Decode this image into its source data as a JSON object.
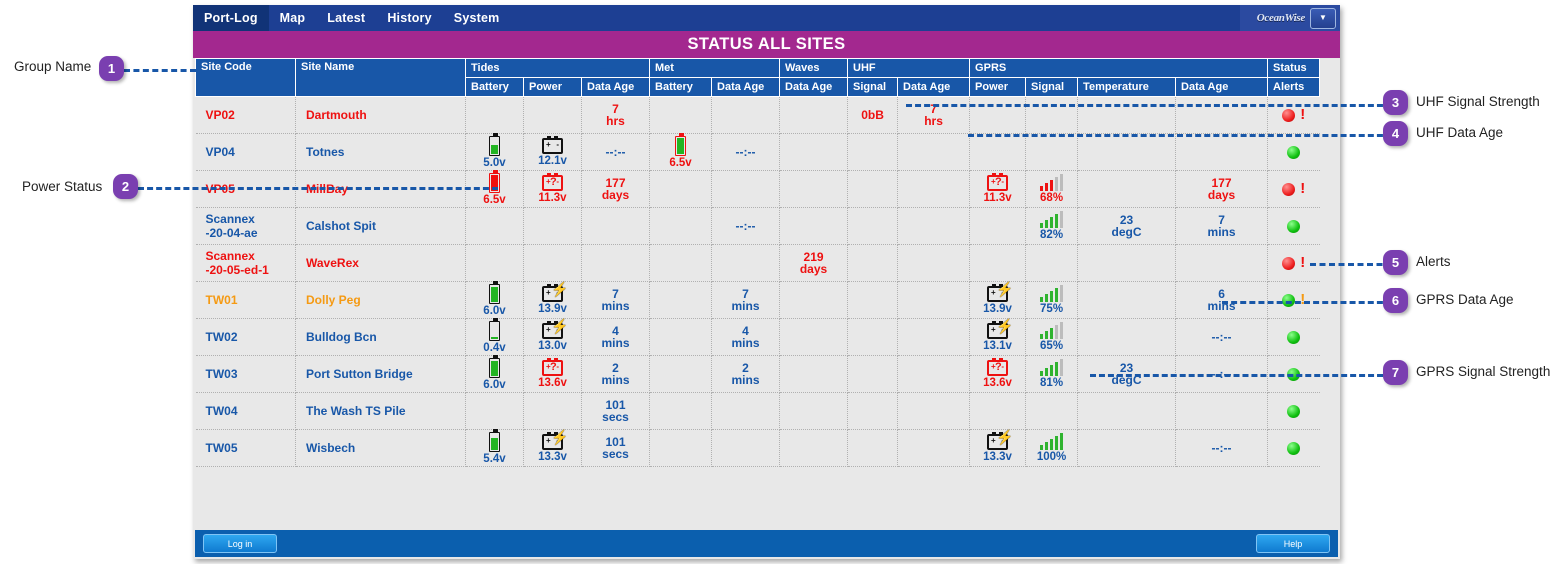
{
  "nav": {
    "items": [
      {
        "label": "Port-Log",
        "active": true
      },
      {
        "label": "Map",
        "active": false
      },
      {
        "label": "Latest",
        "active": false
      },
      {
        "label": "History",
        "active": false
      },
      {
        "label": "System",
        "active": false
      }
    ],
    "brand": "OceanWise",
    "dropdown_icon": "chevron-down-icon"
  },
  "title": "STATUS   ALL SITES",
  "table": {
    "groups": [
      {
        "label": "Site Code",
        "span": 1
      },
      {
        "label": "Site Name",
        "span": 1
      },
      {
        "label": "Tides",
        "span": 3
      },
      {
        "label": "Met",
        "span": 2
      },
      {
        "label": "Waves",
        "span": 1
      },
      {
        "label": "UHF",
        "span": 2
      },
      {
        "label": "GPRS",
        "span": 4
      },
      {
        "label": "Status",
        "span": 1
      }
    ],
    "columns": [
      "Site Code",
      "Site Name",
      "Battery",
      "Power",
      "Data Age",
      "Battery",
      "Data Age",
      "Data Age",
      "Signal",
      "Data Age",
      "Power",
      "Signal",
      "Temperature",
      "Data Age",
      "Alerts"
    ],
    "rows": [
      {
        "site_code": "VP02",
        "site_name": "Dartmouth",
        "color": "red",
        "tides_battery": null,
        "tides_power": null,
        "tides_data_age": "7 hrs",
        "tides_data_age_color": "red",
        "met_battery": null,
        "met_data_age": null,
        "waves_data_age": null,
        "uhf_signal": "0bB",
        "uhf_signal_color": "red",
        "uhf_data_age": "7 hrs",
        "uhf_data_age_color": "red",
        "gprs_power": null,
        "gprs_signal": null,
        "gprs_temperature": null,
        "gprs_data_age": null,
        "status": "red",
        "alert": true,
        "alert_color": "red"
      },
      {
        "site_code": "VP04",
        "site_name": "Totnes",
        "color": "blue",
        "tides_battery": "5.0v",
        "tides_battery_color": "blue",
        "tides_battery_level": 55,
        "tides_battery_fill": "green",
        "tides_power": "12.1v",
        "tides_power_color": "blue",
        "tides_power_icon": "battery-terminals",
        "tides_data_age": "--:--",
        "tides_data_age_color": "blue",
        "met_battery": "6.5v",
        "met_battery_color": "red",
        "met_battery_level": 95,
        "met_battery_fill": "green",
        "met_data_age": "--:--",
        "met_data_age_color": "blue",
        "waves_data_age": null,
        "uhf_signal": null,
        "uhf_data_age": null,
        "gprs_power": null,
        "gprs_signal": null,
        "gprs_temperature": null,
        "gprs_data_age": null,
        "status": "green",
        "alert": false
      },
      {
        "site_code": "VP05",
        "site_name": "MillBay",
        "color": "red",
        "tides_battery": "6.5v",
        "tides_battery_color": "red",
        "tides_battery_level": 95,
        "tides_battery_fill": "red",
        "tides_power": "11.3v",
        "tides_power_color": "red",
        "tides_power_icon": "battery-fault",
        "tides_data_age": "177 days",
        "tides_data_age_color": "red",
        "met_battery": null,
        "met_data_age": null,
        "waves_data_age": null,
        "uhf_signal": null,
        "uhf_data_age": null,
        "gprs_power": "11.3v",
        "gprs_power_color": "red",
        "gprs_power_icon": "battery-fault",
        "gprs_signal": "68%",
        "gprs_signal_color": "red",
        "gprs_signal_pct": 68,
        "gprs_temperature": null,
        "gprs_data_age": "177 days",
        "gprs_data_age_color": "red",
        "status": "red",
        "alert": true,
        "alert_color": "red"
      },
      {
        "site_code": "Scannex -20-04-ae",
        "site_name": "Calshot Spit",
        "color": "blue",
        "tides_battery": null,
        "tides_power": null,
        "tides_data_age": null,
        "met_battery": null,
        "met_data_age": "--:--",
        "met_data_age_color": "blue",
        "waves_data_age": null,
        "uhf_signal": null,
        "uhf_data_age": null,
        "gprs_power": null,
        "gprs_signal": "82%",
        "gprs_signal_color": "green",
        "gprs_signal_pct": 82,
        "gprs_temperature": "23 degC",
        "gprs_temperature_color": "blue",
        "gprs_data_age": "7 mins",
        "gprs_data_age_color": "blue",
        "status": "green",
        "alert": false
      },
      {
        "site_code": "Scannex -20-05-ed-1",
        "site_name": "WaveRex",
        "color": "red",
        "tides_battery": null,
        "tides_power": null,
        "tides_data_age": null,
        "met_battery": null,
        "met_data_age": null,
        "waves_data_age": "219 days",
        "waves_data_age_color": "red",
        "uhf_signal": null,
        "uhf_data_age": null,
        "gprs_power": null,
        "gprs_signal": null,
        "gprs_temperature": null,
        "gprs_data_age": null,
        "status": "red",
        "alert": true,
        "alert_color": "red"
      },
      {
        "site_code": "TW01",
        "site_name": "Dolly Peg",
        "color": "orange",
        "tides_battery": "6.0v",
        "tides_battery_color": "blue",
        "tides_battery_level": 90,
        "tides_battery_fill": "green",
        "tides_power": "13.9v",
        "tides_power_color": "blue",
        "tides_power_icon": "battery-charging",
        "tides_data_age": "7 mins",
        "tides_data_age_color": "blue",
        "met_battery": null,
        "met_data_age": "7 mins",
        "met_data_age_color": "blue",
        "waves_data_age": null,
        "uhf_signal": null,
        "uhf_data_age": null,
        "gprs_power": "13.9v",
        "gprs_power_color": "blue",
        "gprs_power_icon": "battery-charging",
        "gprs_signal": "75%",
        "gprs_signal_color": "green",
        "gprs_signal_pct": 75,
        "gprs_temperature": null,
        "gprs_data_age": "6 mins",
        "gprs_data_age_color": "blue",
        "status": "green",
        "alert": true,
        "alert_color": "orange"
      },
      {
        "site_code": "TW02",
        "site_name": "Bulldog Bcn",
        "color": "blue",
        "tides_battery": "0.4v",
        "tides_battery_color": "blue",
        "tides_battery_level": 6,
        "tides_battery_fill": "green",
        "tides_power": "13.0v",
        "tides_power_color": "blue",
        "tides_power_icon": "battery-charging",
        "tides_data_age": "4 mins",
        "tides_data_age_color": "blue",
        "met_battery": null,
        "met_data_age": "4 mins",
        "met_data_age_color": "blue",
        "waves_data_age": null,
        "uhf_signal": null,
        "uhf_data_age": null,
        "gprs_power": "13.1v",
        "gprs_power_color": "blue",
        "gprs_power_icon": "battery-charging",
        "gprs_signal": "65%",
        "gprs_signal_color": "green",
        "gprs_signal_pct": 65,
        "gprs_temperature": null,
        "gprs_data_age": "--:--",
        "gprs_data_age_color": "blue",
        "status": "green",
        "alert": false
      },
      {
        "site_code": "TW03",
        "site_name": "Port Sutton Bridge",
        "color": "blue",
        "tides_battery": "6.0v",
        "tides_battery_color": "blue",
        "tides_battery_level": 90,
        "tides_battery_fill": "green",
        "tides_power": "13.6v",
        "tides_power_color": "red",
        "tides_power_icon": "battery-fault",
        "tides_data_age": "2 mins",
        "tides_data_age_color": "blue",
        "met_battery": null,
        "met_data_age": "2 mins",
        "met_data_age_color": "blue",
        "waves_data_age": null,
        "uhf_signal": null,
        "uhf_data_age": null,
        "gprs_power": "13.6v",
        "gprs_power_color": "red",
        "gprs_power_icon": "battery-fault",
        "gprs_signal": "81%",
        "gprs_signal_color": "green",
        "gprs_signal_pct": 81,
        "gprs_temperature": "23 degC",
        "gprs_temperature_color": "blue",
        "gprs_data_age": "--:--",
        "gprs_data_age_color": "blue",
        "status": "green",
        "alert": false
      },
      {
        "site_code": "TW04",
        "site_name": "The Wash TS Pile",
        "color": "blue",
        "tides_battery": null,
        "tides_power": null,
        "tides_data_age": "101 secs",
        "tides_data_age_color": "blue",
        "met_battery": null,
        "met_data_age": null,
        "waves_data_age": null,
        "uhf_signal": null,
        "uhf_data_age": null,
        "gprs_power": null,
        "gprs_signal": null,
        "gprs_temperature": null,
        "gprs_data_age": null,
        "status": "green",
        "alert": false
      },
      {
        "site_code": "TW05",
        "site_name": "Wisbech",
        "color": "blue",
        "tides_battery": "5.4v",
        "tides_battery_color": "blue",
        "tides_battery_level": 70,
        "tides_battery_fill": "green",
        "tides_power": "13.3v",
        "tides_power_color": "blue",
        "tides_power_icon": "battery-charging",
        "tides_data_age": "101 secs",
        "tides_data_age_color": "blue",
        "met_battery": null,
        "met_data_age": null,
        "waves_data_age": null,
        "uhf_signal": null,
        "uhf_data_age": null,
        "gprs_power": "13.3v",
        "gprs_power_color": "blue",
        "gprs_power_icon": "battery-charging",
        "gprs_signal": "100%",
        "gprs_signal_color": "green",
        "gprs_signal_pct": 100,
        "gprs_temperature": null,
        "gprs_data_age": "--:--",
        "gprs_data_age_color": "blue",
        "status": "green",
        "alert": false
      }
    ]
  },
  "footer": {
    "login_label": "Log in",
    "help_label": "Help"
  },
  "annotations": [
    {
      "num": "1",
      "label": "Group Name"
    },
    {
      "num": "2",
      "label": "Power Status"
    },
    {
      "num": "3",
      "label": "UHF Signal Strength"
    },
    {
      "num": "4",
      "label": "UHF Data Age"
    },
    {
      "num": "5",
      "label": "Alerts"
    },
    {
      "num": "6",
      "label": "GPRS Data Age"
    },
    {
      "num": "7",
      "label": "GPRS Signal Strength"
    }
  ],
  "colors": {
    "nav_bg": "#1d3f93",
    "title_bg": "#a3288f",
    "header_bg": "#1857a8",
    "row_bg": "#e8e8e8",
    "blue_text": "#1857a8",
    "red_text": "#ee1111",
    "orange_text": "#f59a13",
    "green": "#22b422",
    "annotation": "#7a3fb0"
  }
}
